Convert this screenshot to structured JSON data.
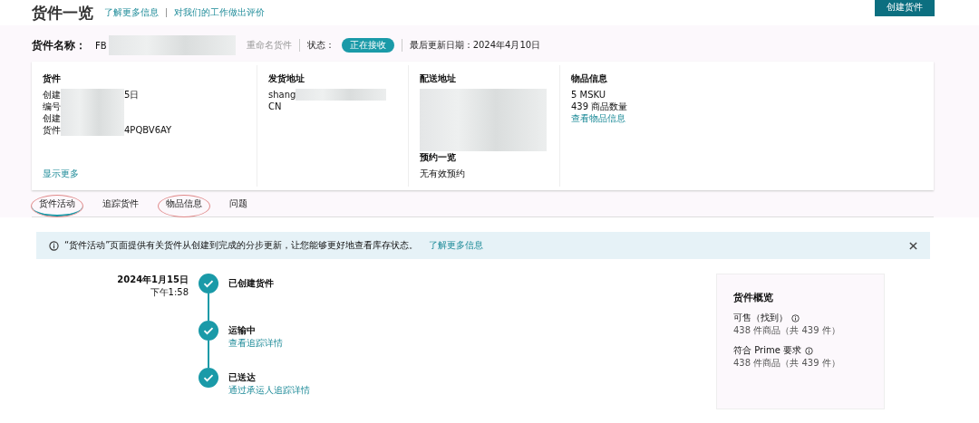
{
  "header": {
    "title": "货件一览",
    "links": [
      "了解更多信息",
      "对我们的工作做出评价"
    ],
    "create_button": "创建货件"
  },
  "shipment_bar": {
    "name_label": "货件名称：",
    "name_value": "FB",
    "rename": "重命名货件",
    "status_label": "状态：",
    "status": "正在接收",
    "updated": "最后更新日期：2024年4月10日"
  },
  "details": [
    {
      "heading": "货件",
      "lines": [
        {
          "text": "创建",
          "tail": "5日"
        },
        {
          "text": "编号"
        },
        {
          "text": "创建"
        },
        {
          "text": "货件",
          "tail": "4PQBV6AY"
        }
      ],
      "link": "显示更多"
    },
    {
      "heading": "发货地址",
      "lines": [
        {
          "text": "shang"
        },
        {
          "text": "CN"
        }
      ]
    },
    {
      "heading": "配送地址",
      "sub_heading": "预约一览",
      "sub_text": "无有效预约"
    },
    {
      "heading": "物品信息",
      "lines": [
        {
          "text": "5 MSKU"
        },
        {
          "text": "439 商品数量"
        }
      ],
      "link": "查看物品信息"
    }
  ],
  "tabs": [
    {
      "label": "货件活动",
      "selected": true,
      "circled": true
    },
    {
      "label": "追踪货件",
      "selected": false,
      "circled": false
    },
    {
      "label": "物品信息",
      "selected": false,
      "circled": true
    },
    {
      "label": "问题",
      "selected": false,
      "circled": false
    }
  ],
  "alert": {
    "text": "“货件活动”页面提供有关货件从创建到完成的分步更新，让您能够更好地查看库存状态。",
    "link": "了解更多信息"
  },
  "timeline": [
    {
      "date": "2024年1月15日",
      "time": "下午1:58",
      "title": "已创建货件",
      "done": true
    },
    {
      "title": "运输中",
      "link": "查看追踪详情",
      "done": true
    },
    {
      "title": "已送达",
      "link": "通过承运人追踪详情",
      "done": true
    }
  ],
  "overview": {
    "title": "货件概览",
    "rows": [
      {
        "label": "可售（找到）",
        "value": "438 件商品（共 439 件）"
      },
      {
        "label": "符合 Prime 要求",
        "value": "438 件商品（共 439 件）"
      }
    ]
  }
}
